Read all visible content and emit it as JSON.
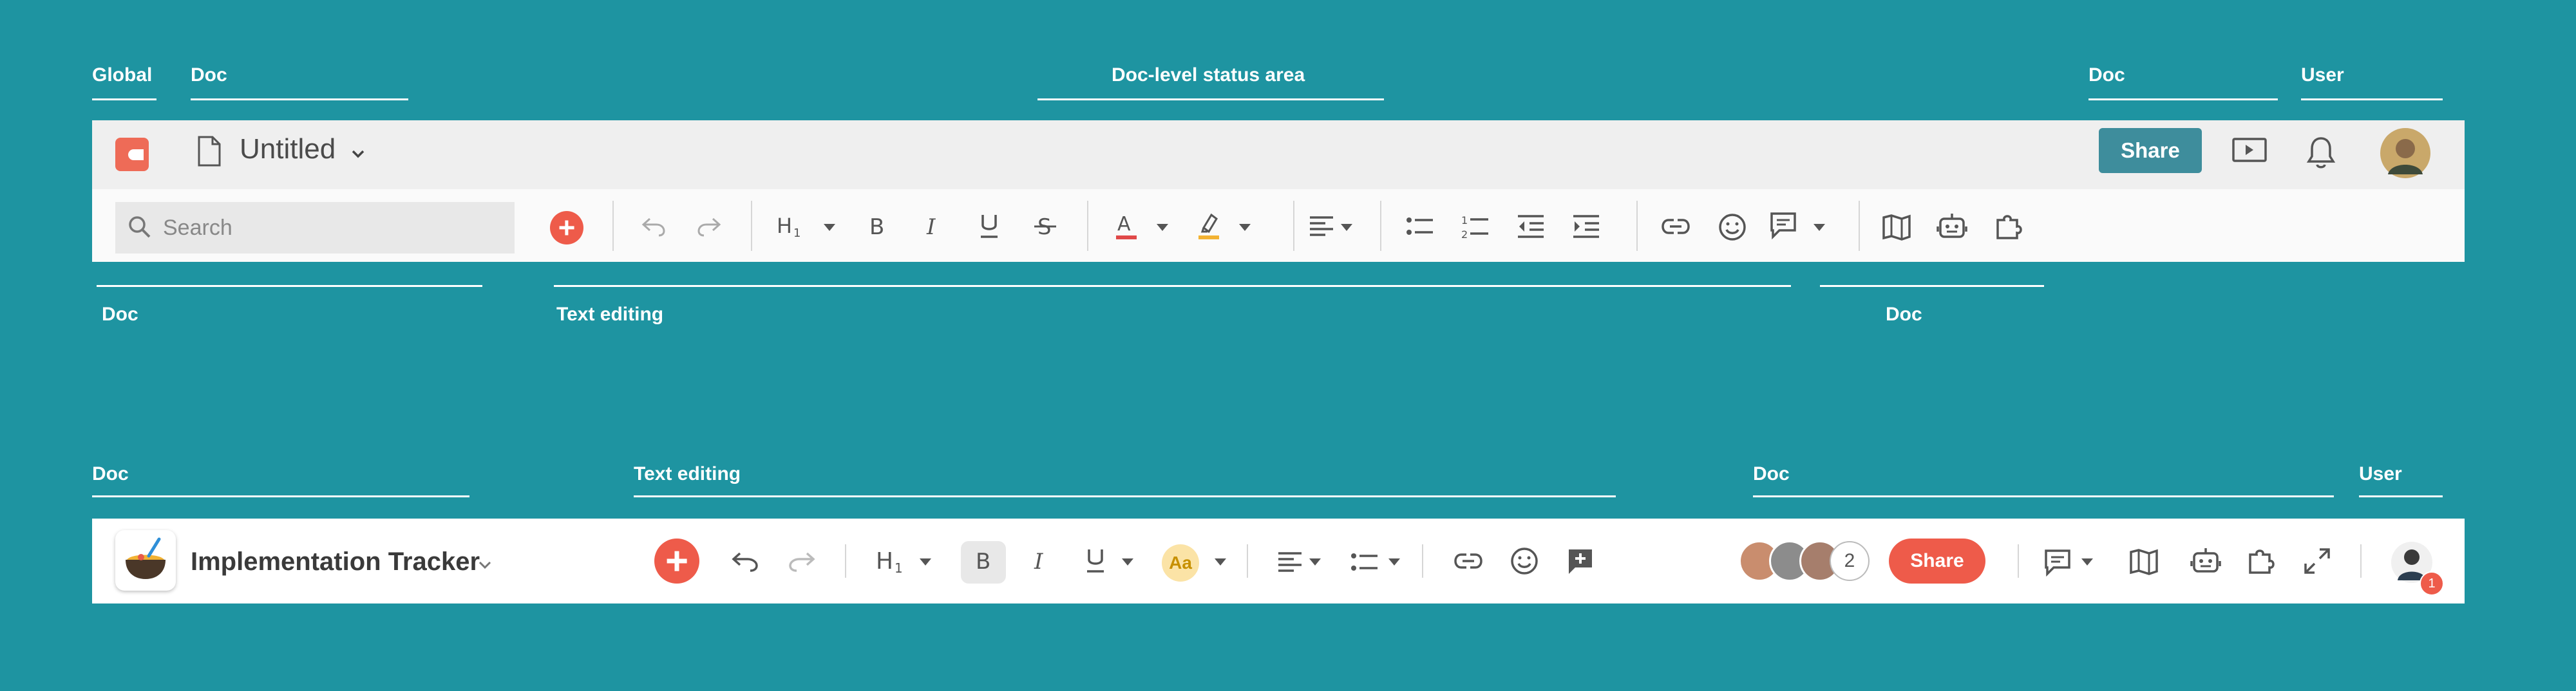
{
  "annotations_top": {
    "global": "Global",
    "doc_left": "Doc",
    "status_area": "Doc-level status area",
    "doc_right": "Doc",
    "user": "User"
  },
  "toolbar1": {
    "title": "Untitled",
    "share_label": "Share",
    "search_placeholder": "Search",
    "icons": [
      "logo-icon",
      "document-icon",
      "chevron-down-icon",
      "present-icon",
      "bell-icon",
      "avatar",
      "search-icon",
      "add-icon",
      "undo-icon",
      "redo-icon",
      "heading-icon",
      "bold-icon",
      "italic-icon",
      "underline-icon",
      "strikethrough-icon",
      "text-color-icon",
      "highlight-icon",
      "align-icon",
      "bullet-list-icon",
      "numbered-list-icon",
      "outdent-icon",
      "indent-icon",
      "link-icon",
      "emoji-icon",
      "comment-icon",
      "map-icon",
      "robot-icon",
      "puzzle-icon"
    ],
    "colors": {
      "bar_top": "#efefef",
      "bar_bottom": "#fafafa",
      "share": "#3e8d9c",
      "add": "#ee5b4a",
      "logo": "#ee6b57"
    }
  },
  "annotations_mid": {
    "doc_left": "Doc",
    "text_editing": "Text editing",
    "doc_right": "Doc"
  },
  "annotations_bottom": {
    "doc_left": "Doc",
    "text_editing": "Text editing",
    "doc_right": "Doc",
    "user": "User"
  },
  "toolbar2": {
    "title": "Implementation Tracker",
    "share_label": "Share",
    "collaborator_count": "2",
    "notification_count": "1",
    "text_style_label": "Aa",
    "icons": [
      "bowl-logo-icon",
      "chevron-down-icon",
      "add-icon",
      "undo-icon",
      "redo-icon",
      "heading-icon",
      "bold-icon",
      "italic-icon",
      "underline-icon",
      "text-style-icon",
      "align-icon",
      "bullet-list-icon",
      "link-icon",
      "emoji-icon",
      "add-comment-icon",
      "collaborator-avatars",
      "comment-icon",
      "map-icon",
      "robot-icon",
      "puzzle-icon",
      "expand-icon",
      "avatar"
    ],
    "colors": {
      "background": "#ffffff",
      "share": "#ee5b4a",
      "add": "#ee5b4a",
      "text_style_bg": "#fbe3a6"
    }
  },
  "colors": {
    "background": "#1e94a1",
    "annotation": "#ffffff"
  }
}
